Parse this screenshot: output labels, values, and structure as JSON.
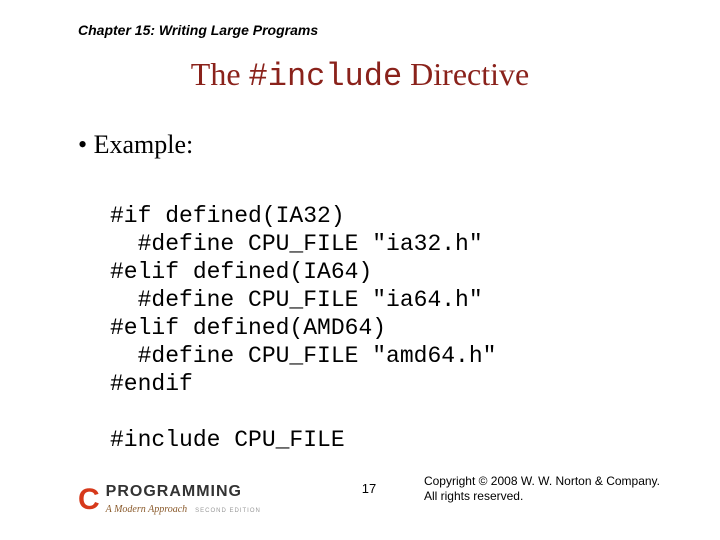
{
  "chapter": "Chapter 15: Writing Large Programs",
  "title_pre": "The ",
  "title_code": "#include",
  "title_post": " Directive",
  "bullet_label": "•  Example:",
  "code_lines": [
    "#if defined(IA32)",
    "  #define CPU_FILE \"ia32.h\"",
    "#elif defined(IA64)",
    "  #define CPU_FILE \"ia64.h\"",
    "#elif defined(AMD64)",
    "  #define CPU_FILE \"amd64.h\"",
    "#endif",
    "",
    "#include CPU_FILE"
  ],
  "logo": {
    "c": "C",
    "prog": "PROGRAMMING",
    "tagline": "A Modern Approach",
    "edition": "SECOND EDITION"
  },
  "page_number": "17",
  "copyright_l1": "Copyright © 2008 W. W. Norton & Company.",
  "copyright_l2": "All rights reserved."
}
